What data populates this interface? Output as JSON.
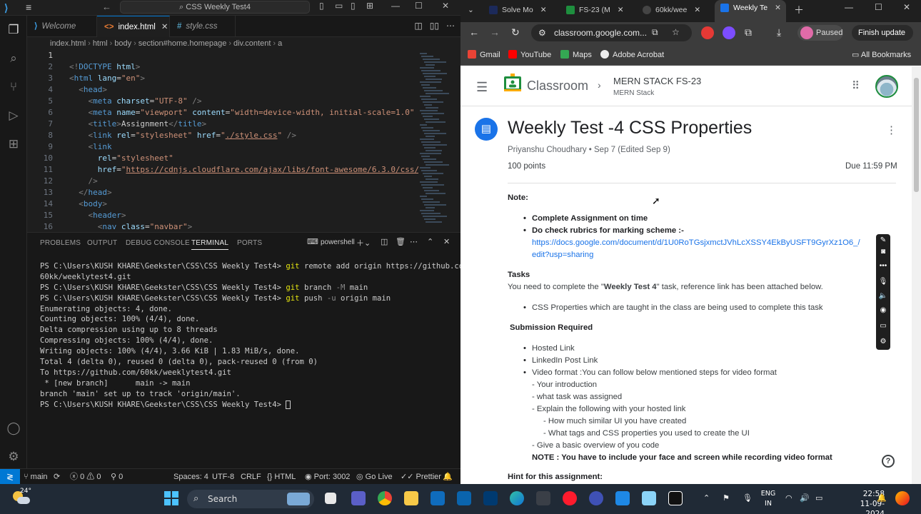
{
  "vscode": {
    "window_title": "CSS Weekly Test4",
    "tabs": [
      {
        "label": "Welcome"
      },
      {
        "label": "index.html"
      },
      {
        "label": "style.css"
      }
    ],
    "breadcrumb": [
      "index.html",
      "html",
      "body",
      "section#home.homepage",
      "div.content",
      "a"
    ],
    "code_lines": [
      {
        "n": "1",
        "html": ""
      },
      {
        "n": "2",
        "html": "<span class='c-br'>&lt;!</span><span class='c-tag'>DOCTYPE</span> <span class='c-attr'>html</span><span class='c-br'>&gt;</span>"
      },
      {
        "n": "3",
        "html": "<span class='c-br'>&lt;</span><span class='c-tag'>html</span> <span class='c-attr'>lang</span>=<span class='c-str'>\"en\"</span><span class='c-br'>&gt;</span>"
      },
      {
        "n": "4",
        "html": "  <span class='c-br'>&lt;</span><span class='c-tag'>head</span><span class='c-br'>&gt;</span>"
      },
      {
        "n": "5",
        "html": "    <span class='c-br'>&lt;</span><span class='c-tag'>meta</span> <span class='c-attr'>charset</span>=<span class='c-str'>\"UTF-8\"</span> <span class='c-br'>/&gt;</span>"
      },
      {
        "n": "6",
        "html": "    <span class='c-br'>&lt;</span><span class='c-tag'>meta</span> <span class='c-attr'>name</span>=<span class='c-str'>\"viewport\"</span> <span class='c-attr'>content</span>=<span class='c-str'>\"width=device-width, initial-scale=1.0\"</span>"
      },
      {
        "n": "7",
        "html": "    <span class='c-br'>&lt;</span><span class='c-tag'>title</span><span class='c-br'>&gt;</span>Assignment<span class='c-br'>&lt;/</span><span class='c-tag'>title</span><span class='c-br'>&gt;</span>"
      },
      {
        "n": "8",
        "html": "    <span class='c-br'>&lt;</span><span class='c-tag'>link</span> <span class='c-attr'>rel</span>=<span class='c-str'>\"stylesheet\"</span> <span class='c-attr'>href</span>=<span class='c-str'>\"<u>./style.css</u>\"</span> <span class='c-br'>/&gt;</span>"
      },
      {
        "n": "9",
        "html": "    <span class='c-br'>&lt;</span><span class='c-tag'>link</span>"
      },
      {
        "n": "10",
        "html": "      <span class='c-attr'>rel</span>=<span class='c-str'>\"stylesheet\"</span>"
      },
      {
        "n": "11",
        "html": "      <span class='c-attr'>href</span>=<span class='c-str'>\"<u>https://cdnjs.cloudflare.com/ajax/libs/font-awesome/6.3.0/css/</u></span>"
      },
      {
        "n": "12",
        "html": "    <span class='c-br'>/&gt;</span>"
      },
      {
        "n": "13",
        "html": "  <span class='c-br'>&lt;/</span><span class='c-tag'>head</span><span class='c-br'>&gt;</span>"
      },
      {
        "n": "14",
        "html": "  <span class='c-br'>&lt;</span><span class='c-tag'>body</span><span class='c-br'>&gt;</span>"
      },
      {
        "n": "15",
        "html": "    <span class='c-br'>&lt;</span><span class='c-tag'>header</span><span class='c-br'>&gt;</span>"
      },
      {
        "n": "16",
        "html": "      <span class='c-br'>&lt;</span><span class='c-tag'>nav</span> <span class='c-attr'>class</span>=<span class='c-str'>\"navbar\"</span><span class='c-br'>&gt;</span>"
      }
    ],
    "panel_tabs": [
      "PROBLEMS",
      "OUTPUT",
      "DEBUG CONSOLE",
      "TERMINAL",
      "PORTS"
    ],
    "terminal_shell": "powershell",
    "terminal_lines": [
      "PS C:\\Users\\KUSH KHARE\\Geekster\\CSS\\CSS Weekly Test4> <span class='t-git'>git</span> remote add origin https://github.com/",
      "60kk/weeklytest4.git",
      "PS C:\\Users\\KUSH KHARE\\Geekster\\CSS\\CSS Weekly Test4> <span class='t-git'>git</span> branch <span class='t-flag'>-M</span> main",
      "PS C:\\Users\\KUSH KHARE\\Geekster\\CSS\\CSS Weekly Test4> <span class='t-git'>git</span> push <span class='t-flag'>-u</span> origin main",
      "Enumerating objects: 4, done.",
      "Counting objects: 100% (4/4), done.",
      "Delta compression using up to 8 threads",
      "Compressing objects: 100% (4/4), done.",
      "Writing objects: 100% (4/4), 3.66 KiB | 1.83 MiB/s, done.",
      "Total 4 (delta 0), reused 0 (delta 0), pack-reused 0 (from 0)",
      "To https://github.com/60kk/weeklytest4.git",
      " * [new branch]      main -> main",
      "branch 'main' set up to track 'origin/main'.",
      "PS C:\\Users\\KUSH KHARE\\Geekster\\CSS\\CSS Weekly Test4> <span class='cursor'></span>"
    ],
    "status": {
      "branch": "main",
      "errors": "0",
      "warnings": "0",
      "ports_fwd": "0",
      "spaces": "Spaces: 4",
      "encoding": "UTF-8",
      "eol": "CRLF",
      "language": "HTML",
      "port": "Port: 3002",
      "golive": "Go Live",
      "prettier": "Prettier"
    }
  },
  "chrome": {
    "tabs": [
      {
        "label": "Solve Mo",
        "color": "#1c2a5a"
      },
      {
        "label": "FS-23 (M",
        "color": "#1e8e3e"
      },
      {
        "label": "60kk/wee",
        "color": "#444444"
      },
      {
        "label": "Weekly Te",
        "color": "#1a73e8"
      }
    ],
    "url": "classroom.google.com...",
    "paused_label": "Paused",
    "finish_label": "Finish update",
    "bookmarks": [
      {
        "label": "Gmail",
        "color": "#ea4335"
      },
      {
        "label": "YouTube",
        "color": "#ff0000"
      },
      {
        "label": "Maps",
        "color": "#34a853"
      },
      {
        "label": "Adobe Acrobat",
        "color": "#eeeeee"
      }
    ],
    "all_bookmarks": "All Bookmarks",
    "classroom": {
      "app_name": "Classroom",
      "course": "MERN STACK FS-23",
      "section": "MERN Stack",
      "title": "Weekly Test -4 CSS Properties",
      "meta": "Priyanshu Choudhary • Sep 7 (Edited Sep 9)",
      "points": "100 points",
      "due": "Due 11:59 PM",
      "note_label": "Note:",
      "note_items": [
        "Complete Assignment on time",
        "Do check rubrics for marking scheme :-"
      ],
      "rubric_link_1": "https://docs.google.com/document/d/1U0RoTGsjxmctJVhLcXSSY4EkByUSFT9GyrXz1O6_/",
      "rubric_link_2": "edit?usp=sharing",
      "tasks_label": "Tasks",
      "tasks_pre": "You need to complete the \"",
      "tasks_bold": "Weekly Test 4",
      "tasks_post": "\" task, reference link has been attached below.",
      "tasks_item": "CSS Properties which are taught in the class are being used to complete this task",
      "submission_label": "Submission Required",
      "submission_items": [
        "Hosted Link",
        "LinkedIn Post Link",
        "Video format :You can follow below mentioned steps for video format"
      ],
      "video_steps": [
        "- Your introduction",
        "- what task was assigned",
        "- Explain the following with your hosted link",
        "- How much similar UI you have created",
        "- What tags and CSS properties you used to create the UI",
        "- Give a basic overview of you code"
      ],
      "note_video": "NOTE : You have to include your face and screen while recording video format",
      "hint_label": "Hint for this assignment:"
    }
  },
  "taskbar": {
    "temperature": "24°",
    "search_placeholder": "Search",
    "lang_1": "ENG",
    "lang_2": "IN",
    "time": "22:58",
    "date": "11-09-2024"
  }
}
